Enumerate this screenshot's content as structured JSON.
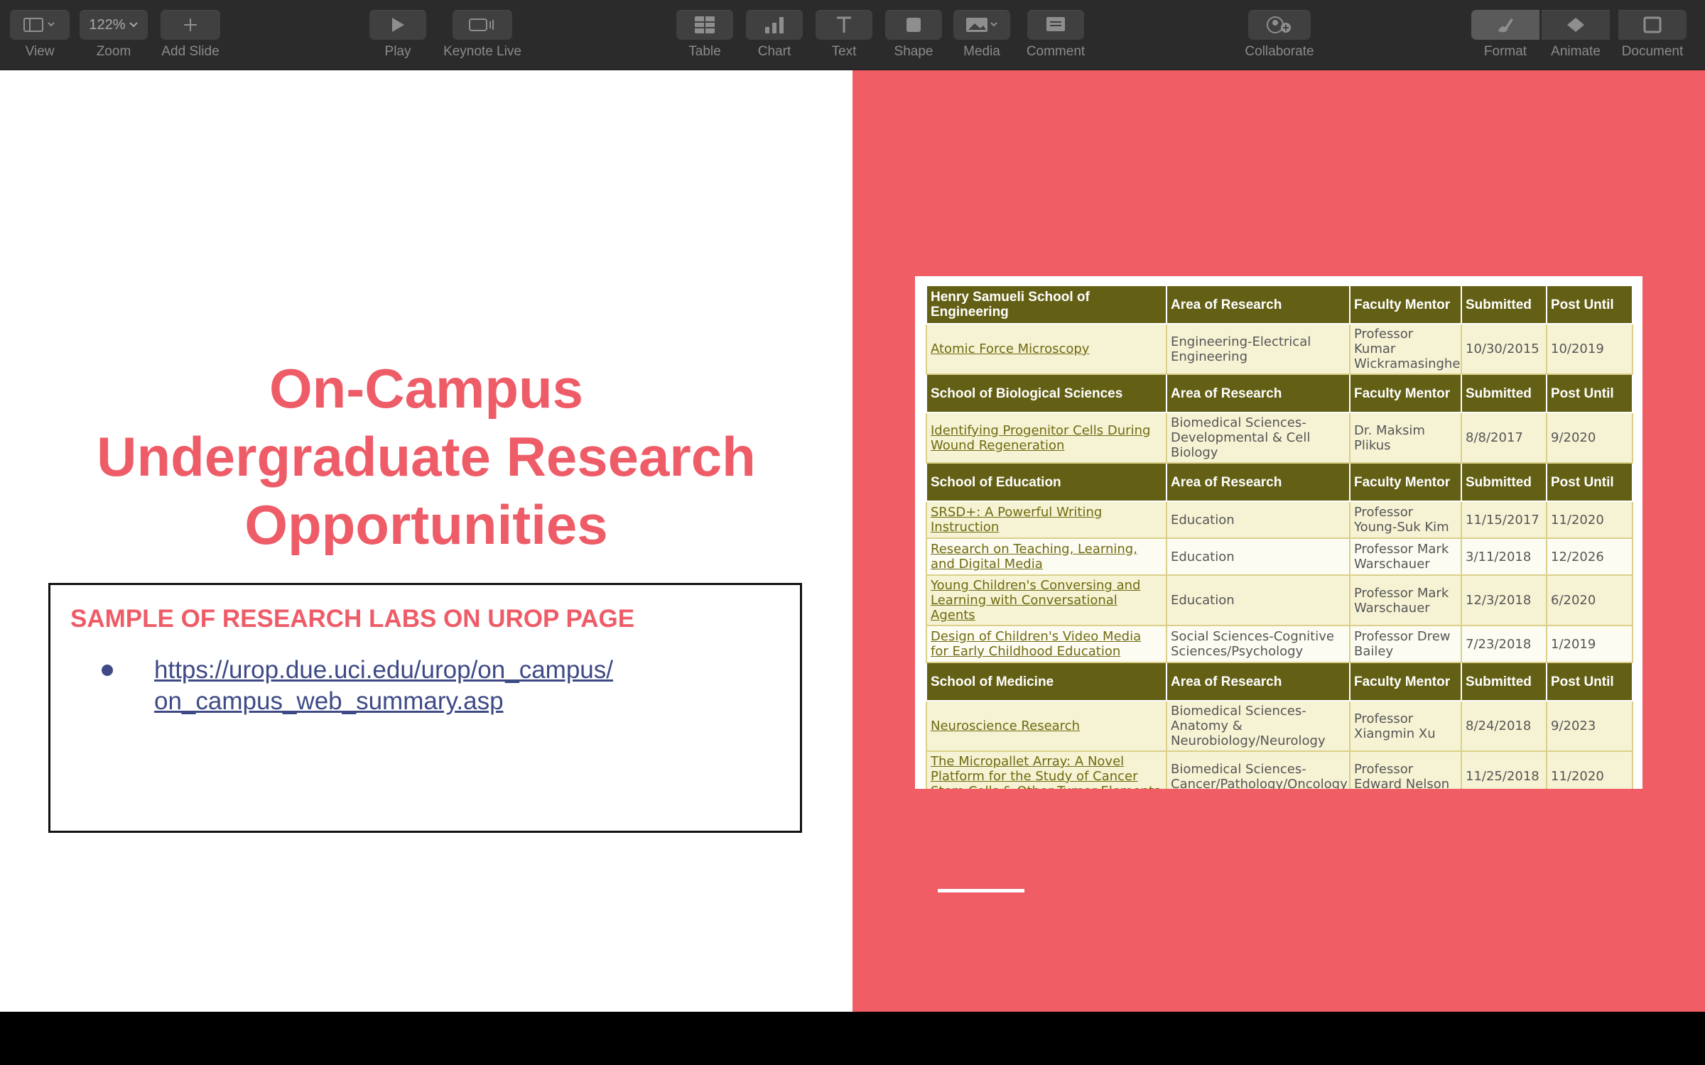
{
  "toolbar": {
    "view": {
      "label": "View",
      "icon": "sidebar-view-icon"
    },
    "zoom": {
      "label": "Zoom",
      "value": "122%"
    },
    "add_slide": {
      "label": "Add Slide",
      "icon": "plus-icon"
    },
    "play": {
      "label": "Play",
      "icon": "play-icon"
    },
    "keynote_live": {
      "label": "Keynote Live",
      "icon": "keynote-live-icon"
    },
    "table": {
      "label": "Table",
      "icon": "table-icon"
    },
    "chart": {
      "label": "Chart",
      "icon": "chart-icon"
    },
    "text": {
      "label": "Text",
      "icon": "text-icon"
    },
    "shape": {
      "label": "Shape",
      "icon": "shape-icon"
    },
    "media": {
      "label": "Media",
      "icon": "media-icon"
    },
    "comment": {
      "label": "Comment",
      "icon": "comment-icon"
    },
    "collaborate": {
      "label": "Collaborate",
      "icon": "collaborate-icon"
    },
    "format": {
      "label": "Format",
      "icon": "paintbrush-icon"
    },
    "animate": {
      "label": "Animate",
      "icon": "animate-icon"
    },
    "document": {
      "label": "Document",
      "icon": "document-icon"
    }
  },
  "slide": {
    "title_lines": [
      "On-Campus",
      "Undergraduate Research",
      "Opportunities"
    ],
    "box_heading": "SAMPLE OF RESEARCH LABS ON UROP PAGE",
    "link_line1": "https://urop.due.uci.edu/urop/on_campus/",
    "link_line2": "on_campus_web_summary.asp",
    "colors": {
      "accent": "#ee5c68",
      "right_panel": "#f05d65",
      "link": "#3e4a86",
      "table_header": "#636015"
    }
  },
  "table": {
    "columns": [
      "Area of Research",
      "Faculty Mentor",
      "Submitted",
      "Post Until"
    ],
    "sections": [
      {
        "school": "Henry Samueli School of Engineering",
        "rows": [
          {
            "project": "Atomic Force Microscopy",
            "area": "Engineering-Electrical Engineering",
            "mentor": "Professor Kumar Wickramasinghe",
            "submitted": "10/30/2015",
            "post_until": "10/2019"
          }
        ]
      },
      {
        "school": "School of Biological Sciences",
        "rows": [
          {
            "project": "Identifying Progenitor Cells During Wound Regeneration",
            "area": "Biomedical Sciences-Developmental & Cell Biology",
            "mentor": "Dr. Maksim Plikus",
            "submitted": "8/8/2017",
            "post_until": "9/2020"
          }
        ]
      },
      {
        "school": "School of Education",
        "rows": [
          {
            "project": "SRSD+: A Powerful Writing Instruction",
            "area": "Education",
            "mentor": "Professor Young-Suk Kim",
            "submitted": "11/15/2017",
            "post_until": "11/2020"
          },
          {
            "project": "Research on Teaching, Learning, and Digital Media",
            "area": "Education",
            "mentor": "Professor Mark Warschauer",
            "submitted": "3/11/2018",
            "post_until": "12/2026"
          },
          {
            "project": "Young Children's Conversing and Learning with Conversational Agents",
            "area": "Education",
            "mentor": "Professor Mark Warschauer",
            "submitted": "12/3/2018",
            "post_until": "6/2020"
          },
          {
            "project": "Design of Children's Video Media for Early Childhood Education",
            "area": "Social Sciences-Cognitive Sciences/Psychology",
            "mentor": "Professor Drew Bailey",
            "submitted": "7/23/2018",
            "post_until": "1/2019"
          }
        ]
      },
      {
        "school": "School of Medicine",
        "rows": [
          {
            "project": "Neuroscience Research",
            "area": "Biomedical Sciences-Anatomy & Neurobiology/Neurology",
            "mentor": "Professor Xiangmin Xu",
            "submitted": "8/24/2018",
            "post_until": "9/2023"
          },
          {
            "project": "The Micropallet Array: A Novel Platform for the Study of Cancer Stem Cells & Other Tumor Elements",
            "area": "Biomedical Sciences-Cancer/Pathology/Oncology",
            "mentor": "Professor Edward Nelson",
            "submitted": "11/25/2018",
            "post_until": "11/2020"
          }
        ]
      }
    ]
  }
}
